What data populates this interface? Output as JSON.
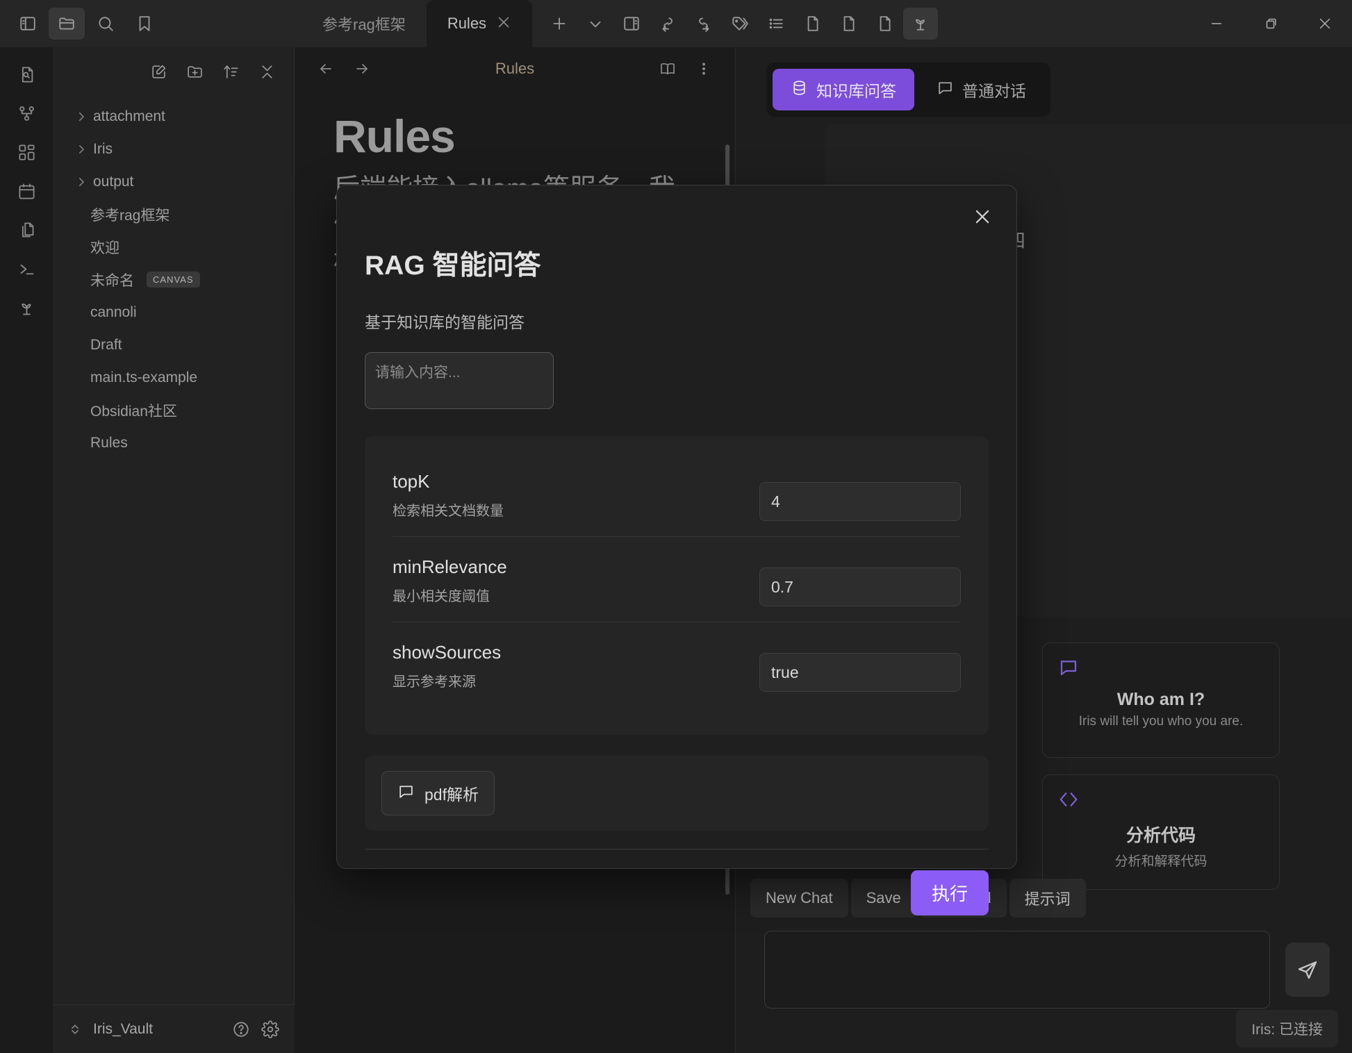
{
  "titlebar": {
    "left_icons": [
      {
        "name": "toggle-left-sidebar-icon",
        "active": false
      },
      {
        "name": "folder-icon",
        "active": true
      },
      {
        "name": "search-icon",
        "active": false
      },
      {
        "name": "bookmark-icon",
        "active": false
      }
    ],
    "inactive_tab_label": "参考rag框架",
    "active_tab_label": "Rules",
    "right_icons": [
      {
        "name": "new-tab-icon"
      },
      {
        "name": "chevron-down-icon"
      },
      {
        "name": "toggle-right-sidebar-icon"
      },
      {
        "name": "link-back-icon"
      },
      {
        "name": "link-forward-icon"
      },
      {
        "name": "tags-icon"
      },
      {
        "name": "outline-list-icon"
      },
      {
        "name": "page-icon-1"
      },
      {
        "name": "page-icon-2"
      },
      {
        "name": "page-icon-3"
      },
      {
        "name": "sprout-icon"
      }
    ],
    "window_controls": [
      "minimize",
      "restore",
      "close"
    ]
  },
  "ribbon": {
    "items": [
      {
        "name": "file-search-icon"
      },
      {
        "name": "graph-view-icon"
      },
      {
        "name": "canvas-icon"
      },
      {
        "name": "calendar-icon"
      },
      {
        "name": "copy-pages-icon"
      },
      {
        "name": "terminal-icon"
      },
      {
        "name": "sprout-icon"
      }
    ]
  },
  "explorer": {
    "toolbar": [
      {
        "name": "new-note-icon"
      },
      {
        "name": "new-folder-icon"
      },
      {
        "name": "sort-icon"
      },
      {
        "name": "collapse-all-icon"
      }
    ],
    "items": [
      {
        "label": "attachment",
        "type": "folder"
      },
      {
        "label": "Iris",
        "type": "folder"
      },
      {
        "label": "output",
        "type": "folder"
      },
      {
        "label": "参考rag框架",
        "type": "file"
      },
      {
        "label": "欢迎",
        "type": "file"
      },
      {
        "label": "未命名",
        "type": "file",
        "badge": "CANVAS"
      },
      {
        "label": "cannoli",
        "type": "file"
      },
      {
        "label": "Draft",
        "type": "file"
      },
      {
        "label": "main.ts-example",
        "type": "file"
      },
      {
        "label": "Obsidian社区",
        "type": "file"
      },
      {
        "label": "Rules",
        "type": "file"
      }
    ],
    "vault_name": "Iris_Vault",
    "vault_icons": [
      {
        "name": "help-icon"
      },
      {
        "name": "settings-gear-icon"
      }
    ]
  },
  "editor": {
    "nav": [
      {
        "name": "back-arrow-icon"
      },
      {
        "name": "forward-arrow-icon"
      }
    ],
    "title": "Rules",
    "header_icons": [
      {
        "name": "reading-view-icon"
      },
      {
        "name": "more-options-icon"
      }
    ],
    "heading": "Rules",
    "paragraph": "后端能接入ollama等服务，我们自己的后端通过tslangchain框架，进行rag服务。"
  },
  "chat": {
    "tabs": [
      {
        "label": "知识库问答",
        "icon": "database-icon",
        "active": true
      },
      {
        "label": "普通对话",
        "icon": "chat-bubble-icon",
        "active": false
      }
    ],
    "message_fragment": "明四",
    "suggestions": [
      {
        "icon": "chat-bubble-icon",
        "title": "Who am I?",
        "subtitle": "Iris will tell you who you are."
      },
      {
        "icon": "code-brackets-icon",
        "title": "分析代码",
        "subtitle": "分析和解释代码"
      }
    ],
    "actions": [
      "New Chat",
      "Save",
      "Clear All",
      "提示词"
    ],
    "input_value": "",
    "input_placeholder": "",
    "send_icon": "send-paper-plane-icon",
    "connection_status": "Iris: 已连接"
  },
  "modal": {
    "close_icon": "close-icon",
    "title": "RAG 智能问答",
    "subtitle": "基于知识库的智能问答",
    "input_value": "",
    "input_placeholder": "请输入内容...",
    "params": [
      {
        "name": "topK",
        "desc": "检索相关文档数量",
        "value": "4"
      },
      {
        "name": "minRelevance",
        "desc": "最小相关度阈值",
        "value": "0.7"
      },
      {
        "name": "showSources",
        "desc": "显示参考来源",
        "value": "true"
      }
    ],
    "pdf_button": {
      "label": "pdf解析",
      "icon": "chat-bubble-icon"
    },
    "run_button": "执行"
  },
  "colors": {
    "accent_purple": "#8b5cf6",
    "tab_purple": "#7c4ddb",
    "window_bg": "#1e1e1e",
    "panel_bg": "#222222",
    "modal_bg": "#1f1f1f"
  }
}
